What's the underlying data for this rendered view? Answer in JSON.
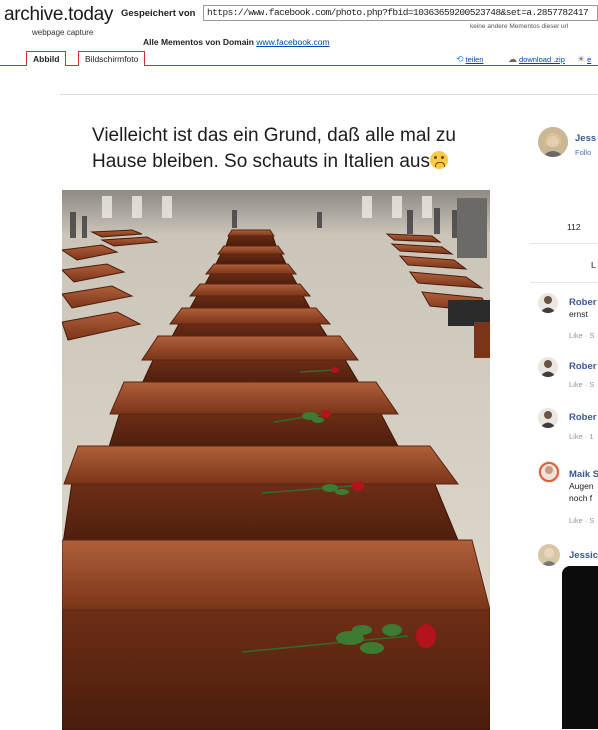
{
  "archive": {
    "logo": "archive.today",
    "logo_sub": "webpage capture",
    "saved_from_label": "Gespeichert von",
    "url": "https://www.facebook.com/photo.php?fbid=10363659200523748&set=a.2857782417",
    "no_other_mementos": "keine andere Mementos dieser url",
    "all_mementos_label": "Alle Mementos  von Domain",
    "domain_link": "www.facebook.com",
    "tabs": [
      {
        "label": "Abbild"
      },
      {
        "label": "Bildschirmfoto"
      }
    ],
    "tools": {
      "share": "teilen",
      "download": "download .zip",
      "extra": "e"
    }
  },
  "post": {
    "text_line1": "Vielleicht ist das ein Grund, daß alle mal zu",
    "text_line2": "Hause bleiben. So schauts in Italien aus",
    "image_icon": "crying-face-emoji",
    "photo_alt_content": "rows-of-coffins-with-roses"
  },
  "side_panel": {
    "author": {
      "name": "Jess",
      "follow": "Follo"
    },
    "reaction_count": "112",
    "like_tab": "L",
    "comments": [
      {
        "name": "Rober",
        "text": "ernst",
        "meta": "Like · S"
      },
      {
        "name": "Rober",
        "text": "",
        "meta": "Like · S"
      },
      {
        "name": "Rober",
        "text": "",
        "meta": "Like · 1"
      },
      {
        "name": "Maik S",
        "text_line1": "Augen",
        "text_line2": "noch f",
        "meta": "Like · S"
      },
      {
        "name": "Jessic"
      }
    ]
  },
  "colors": {
    "link": "#385898",
    "tab_border": "#cc3333",
    "coffin": "#8a3f24"
  }
}
